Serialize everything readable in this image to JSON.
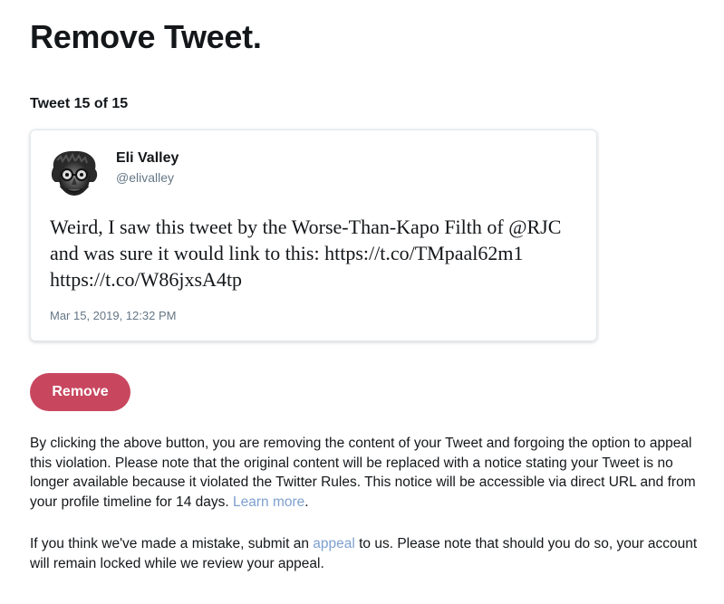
{
  "page": {
    "title": "Remove Tweet.",
    "counter": "Tweet 15 of 15"
  },
  "tweet": {
    "author_name": "Eli Valley",
    "author_handle": "@elivalley",
    "text": "Weird, I saw this tweet by the Worse-Than-Kapo Filth of @RJC and was sure it would link to this: https://t.co/TMpaal62m1 https://t.co/W86jxsA4tp",
    "timestamp": "Mar 15, 2019, 12:32 PM",
    "avatar_icon": "avatar-icon"
  },
  "actions": {
    "remove_label": "Remove",
    "remove_color": "#c8475f"
  },
  "notice": {
    "paragraph1": "By clicking the above button, you are removing the content of your Tweet and forgoing the option to appeal this violation. Please note that the original content will be replaced with a notice stating your Tweet is no longer available because it violated the Twitter Rules. This notice will be accessible via direct URL and from your profile timeline for 14 days.",
    "learn_more_label": "Learn more",
    "learn_more_suffix": ".",
    "paragraph2_before": "If you think we've made a mistake, submit an",
    "appeal_label": "appeal",
    "paragraph2_after": "to us. Please note that should you do so, your account will remain locked while we review your appeal.",
    "link_color": "#7ea0d0"
  }
}
